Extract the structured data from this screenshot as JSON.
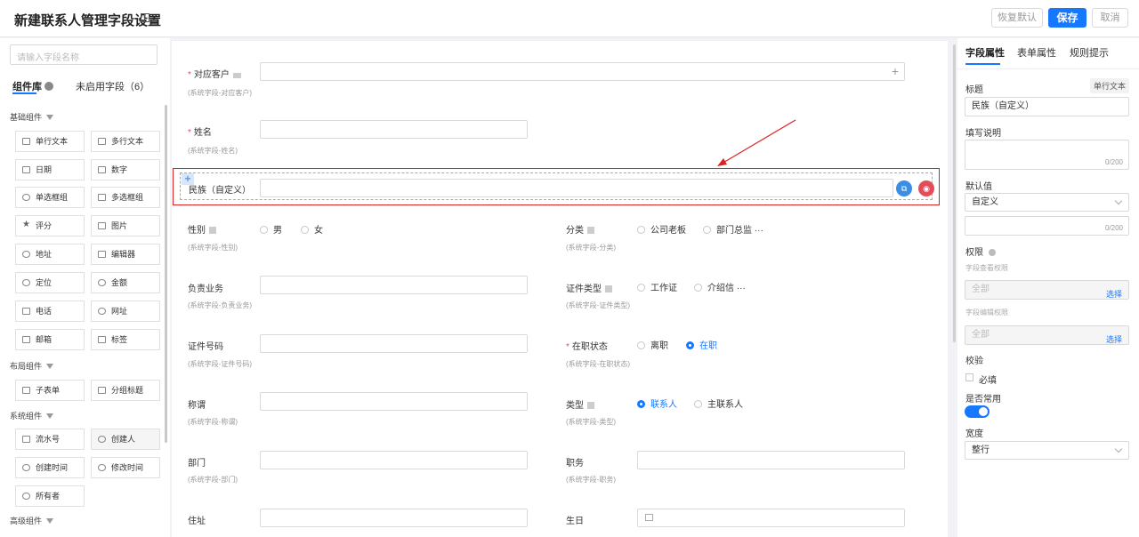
{
  "header": {
    "title": "新建联系人管理字段设置",
    "restore_label": "恢复默认",
    "save_label": "保存",
    "cancel_label": "取消"
  },
  "colors": {
    "primary": "#1677ff",
    "danger": "#e34d59",
    "highlight_frame": "#e02020"
  },
  "left": {
    "search_placeholder": "请输入字段名称",
    "tabs": [
      "组件库",
      "未启用字段（6）"
    ],
    "groups": [
      "基础组件",
      "布局组件",
      "系统组件",
      "高级组件"
    ],
    "basic": [
      {
        "label": "单行文本",
        "icon": "text-icon"
      },
      {
        "label": "多行文本",
        "icon": "textarea-icon"
      },
      {
        "label": "日期",
        "icon": "calendar-icon"
      },
      {
        "label": "数字",
        "icon": "number-icon"
      },
      {
        "label": "单选框组",
        "icon": "radio-icon"
      },
      {
        "label": "多选框组",
        "icon": "checkbox-icon"
      },
      {
        "label": "评分",
        "icon": "star-icon"
      },
      {
        "label": "图片",
        "icon": "image-icon"
      },
      {
        "label": "地址",
        "icon": "location-icon"
      },
      {
        "label": "编辑器",
        "icon": "editor-icon"
      },
      {
        "label": "定位",
        "icon": "pin-icon"
      },
      {
        "label": "金额",
        "icon": "money-icon"
      },
      {
        "label": "电话",
        "icon": "phone-icon"
      },
      {
        "label": "网址",
        "icon": "globe-icon"
      },
      {
        "label": "邮箱",
        "icon": "mail-icon"
      },
      {
        "label": "标签",
        "icon": "tag-icon"
      }
    ],
    "layout": [
      {
        "label": "子表单",
        "icon": "table-icon"
      },
      {
        "label": "分组标题",
        "icon": "group-title-icon"
      }
    ],
    "system": [
      {
        "label": "流水号",
        "icon": "serial-icon"
      },
      {
        "label": "创建人",
        "icon": "user-icon"
      },
      {
        "label": "创建时间",
        "icon": "clock-icon"
      },
      {
        "label": "修改时间",
        "icon": "clock-edit-icon"
      },
      {
        "label": "所有者",
        "icon": "owner-icon"
      }
    ]
  },
  "form": {
    "customer": {
      "label": "对应客户",
      "sub": "(系统字段-对应客户)"
    },
    "name": {
      "label": "姓名",
      "sub": "(系统字段-姓名)"
    },
    "ethnic": {
      "label": "民族（自定义）"
    },
    "gender": {
      "label": "性别",
      "sub": "(系统字段-性别)",
      "options": [
        "男",
        "女"
      ]
    },
    "category": {
      "label": "分类",
      "sub": "(系统字段-分类)",
      "options": [
        "公司老板",
        "部门总监"
      ],
      "more": "···"
    },
    "business": {
      "label": "负责业务",
      "sub": "(系统字段-负责业务)"
    },
    "idtype": {
      "label": "证件类型",
      "sub": "(系统字段-证件类型)",
      "options": [
        "工作证",
        "介绍信"
      ],
      "more": "···"
    },
    "idno": {
      "label": "证件号码",
      "sub": "(系统字段-证件号码)"
    },
    "status": {
      "label": "在职状态",
      "sub": "(系统字段-在职状态)",
      "options": [
        "离职",
        "在职"
      ],
      "selected": "在职"
    },
    "title": {
      "label": "称谓",
      "sub": "(系统字段-称谓)"
    },
    "type": {
      "label": "类型",
      "sub": "(系统字段-类型)",
      "options": [
        "联系人",
        "主联系人"
      ],
      "selected": "联系人"
    },
    "dept": {
      "label": "部门",
      "sub": "(系统字段-部门)"
    },
    "position": {
      "label": "职务",
      "sub": "(系统字段-职务)"
    },
    "address": {
      "label": "住址"
    },
    "birthday": {
      "label": "生日"
    }
  },
  "right": {
    "tabs": [
      "字段属性",
      "表单属性",
      "规则提示"
    ],
    "title_label": "标题",
    "field_type": "单行文本",
    "title_value": "民族（自定义）",
    "desc_label": "填写说明",
    "desc_count": "0/200",
    "default_label": "默认值",
    "default_value": "自定义",
    "default_count": "0/200",
    "perm_label": "权限",
    "view_perm": "字段查看权限",
    "edit_perm": "字段编辑权限",
    "all": "全部",
    "select": "选择",
    "verify_label": "校验",
    "required": "必填",
    "common_label": "是否常用",
    "common_on": true,
    "width_label": "宽度",
    "width_value": "整行"
  }
}
